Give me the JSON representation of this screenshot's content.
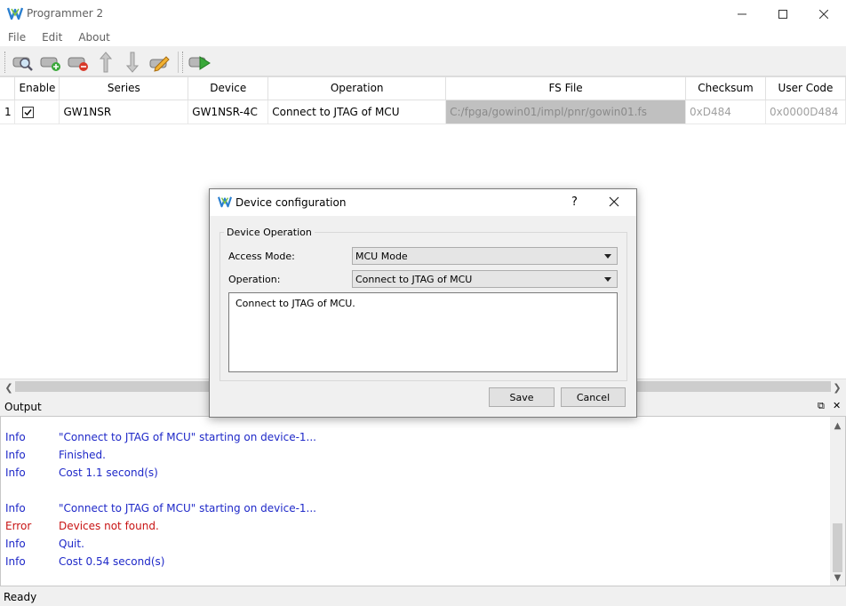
{
  "window": {
    "title": "Programmer 2"
  },
  "menu": {
    "items": [
      "File",
      "Edit",
      "About"
    ]
  },
  "toolbar": {
    "buttons": [
      "scan-device-icon",
      "add-device-icon",
      "remove-device-icon",
      "move-up-icon",
      "move-down-icon",
      "edit-icon",
      "program-icon"
    ]
  },
  "table": {
    "headers": [
      "Enable",
      "Series",
      "Device",
      "Operation",
      "FS File",
      "Checksum",
      "User Code"
    ],
    "rows": [
      {
        "index": "1",
        "enabled": true,
        "series": "GW1NSR",
        "device": "GW1NSR-4C",
        "operation": "Connect to JTAG of MCU",
        "fs_file": "C:/fpga/gowin01/impl/pnr/gowin01.fs",
        "checksum": "0xD484",
        "user_code": "0x0000D484"
      }
    ]
  },
  "output": {
    "label": "Output",
    "lines": [
      {
        "level": "Info",
        "msg": "\"Connect to JTAG of MCU\" starting on device-1..."
      },
      {
        "level": "Info",
        "msg": "Finished."
      },
      {
        "level": "Info",
        "msg": "Cost 1.1 second(s)"
      },
      {
        "level": "Info",
        "msg": "\"Connect to JTAG of MCU\" starting on device-1..."
      },
      {
        "level": "Error",
        "msg": "Devices not found."
      },
      {
        "level": "Info",
        "msg": "Quit."
      },
      {
        "level": "Info",
        "msg": "Cost 0.54 second(s)"
      }
    ]
  },
  "status": {
    "text": "Ready"
  },
  "dialog": {
    "title": "Device configuration",
    "help": "?",
    "group_title": "Device Operation",
    "access_mode_label": "Access Mode:",
    "access_mode_value": "MCU Mode",
    "operation_label": "Operation:",
    "operation_value": "Connect to JTAG of MCU",
    "description": "Connect to JTAG of MCU.",
    "save_label": "Save",
    "cancel_label": "Cancel"
  },
  "colors": {
    "info": "#1e28c8",
    "error": "#c81414",
    "fs_cell_bg": "#c0c0c0"
  }
}
